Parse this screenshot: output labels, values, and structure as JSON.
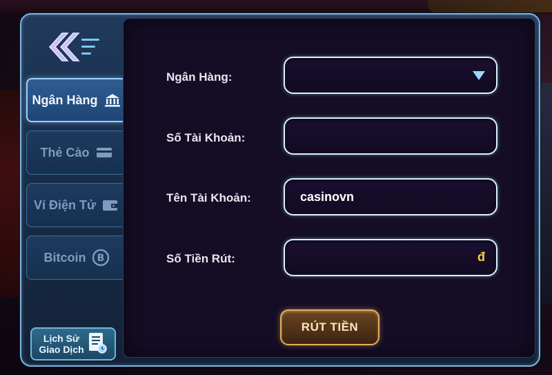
{
  "tabs": [
    {
      "label": "Ngân Hàng",
      "icon": "bank-icon",
      "active": true
    },
    {
      "label": "Thẻ Cào",
      "icon": "card-icon",
      "active": false
    },
    {
      "label": "Ví Điện Tử",
      "icon": "wallet-icon",
      "active": false
    },
    {
      "label": "Bitcoin",
      "icon": "bitcoin-icon",
      "active": false
    }
  ],
  "history": {
    "line1": "Lịch Sử",
    "line2": "Giao Dịch",
    "icon": "receipt-icon"
  },
  "form": {
    "bank_label": "Ngân Hàng:",
    "bank_value": "",
    "account_number_label": "Số Tài Khoản:",
    "account_number_value": "",
    "account_name_label": "Tên Tài Khoản:",
    "account_name_value": "casinovn",
    "amount_label": "Số Tiền Rút:",
    "amount_value": "",
    "currency_symbol": "đ"
  },
  "submit_label": "RÚT TIỀN",
  "colors": {
    "field_border": "#d8f4ff",
    "currency": "#f3d53a",
    "active_tab_border": "#9fd0ff",
    "submit_border": "#e0b060"
  }
}
